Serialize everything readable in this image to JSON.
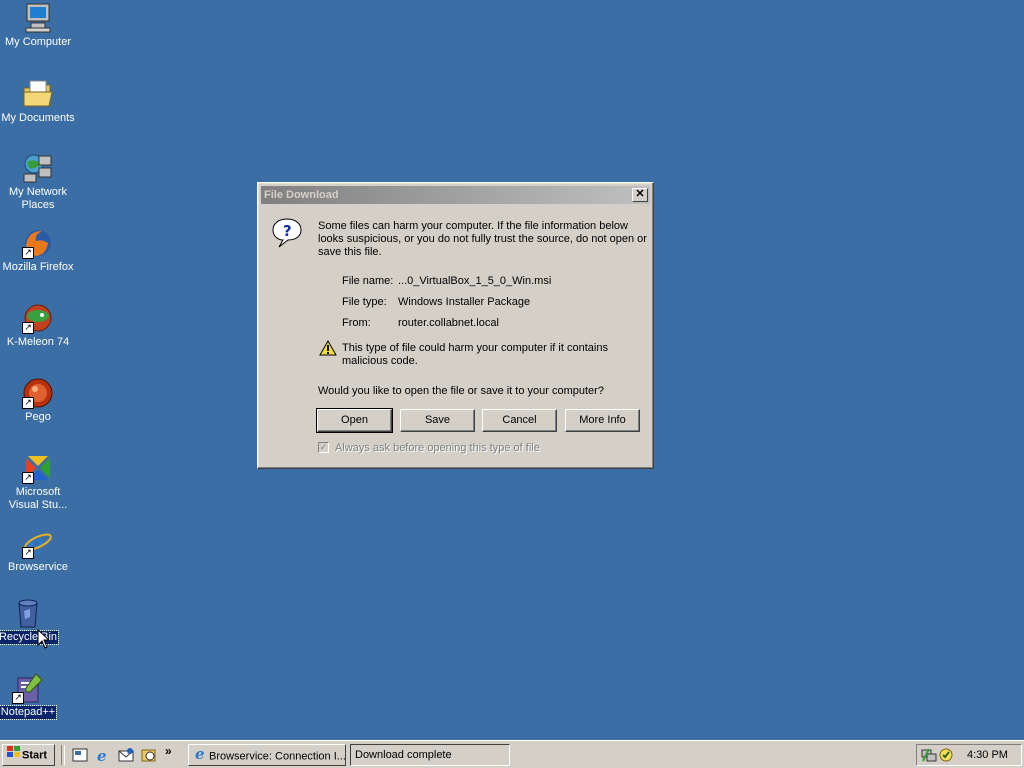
{
  "desktop": {
    "icons": [
      {
        "label": "My Computer",
        "icon": "computer-icon",
        "shortcut": false
      },
      {
        "label": "My Documents",
        "icon": "folder-icon",
        "shortcut": false
      },
      {
        "label_line1": "My Network",
        "label_line2": "Places",
        "icon": "network-icon",
        "shortcut": false
      },
      {
        "label": "Mozilla Firefox",
        "icon": "firefox-icon",
        "shortcut": true
      },
      {
        "label": "K-Meleon 74",
        "icon": "kmeleon-icon",
        "shortcut": true
      },
      {
        "label": "Pego",
        "icon": "pego-icon",
        "shortcut": true
      },
      {
        "label_line1": "Microsoft",
        "label_line2": "Visual Stu...",
        "icon": "visual-studio-icon",
        "shortcut": true
      },
      {
        "label": "Browservice",
        "icon": "ie-icon",
        "shortcut": true
      },
      {
        "label": "Recycle Bin",
        "icon": "recycle-bin-icon",
        "shortcut": false,
        "selected": true
      },
      {
        "label": "Notepad++",
        "icon": "notepadpp-icon",
        "shortcut": true,
        "selected": true
      }
    ]
  },
  "dialog": {
    "title": "File Download",
    "warning_text_1": "Some files can harm your computer. If the file information below",
    "warning_text_2": "looks suspicious, or you do not fully trust the source, do not open or",
    "warning_text_3": "save this file.",
    "file_name_label": "File name:",
    "file_name_value": "...0_VirtualBox_1_5_0_Win.msi",
    "file_type_label": "File type:",
    "file_type_value": "Windows Installer Package",
    "from_label": "From:",
    "from_value": "router.collabnet.local",
    "harm_text_1": "This type of file could harm your computer if it contains",
    "harm_text_2": "malicious code.",
    "question": "Would you like to open the file or save it to your computer?",
    "buttons": {
      "open": "Open",
      "save": "Save",
      "cancel": "Cancel",
      "more_info": "More Info"
    },
    "checkbox_label": "Always ask before opening this type of file",
    "checkbox_checked": true
  },
  "taskbar": {
    "start_label": "Start",
    "tasks": [
      {
        "label": "Browservice: Connection I...",
        "icon": "ie-icon"
      },
      {
        "label": "Download complete"
      }
    ],
    "clock": "4:30 PM"
  }
}
